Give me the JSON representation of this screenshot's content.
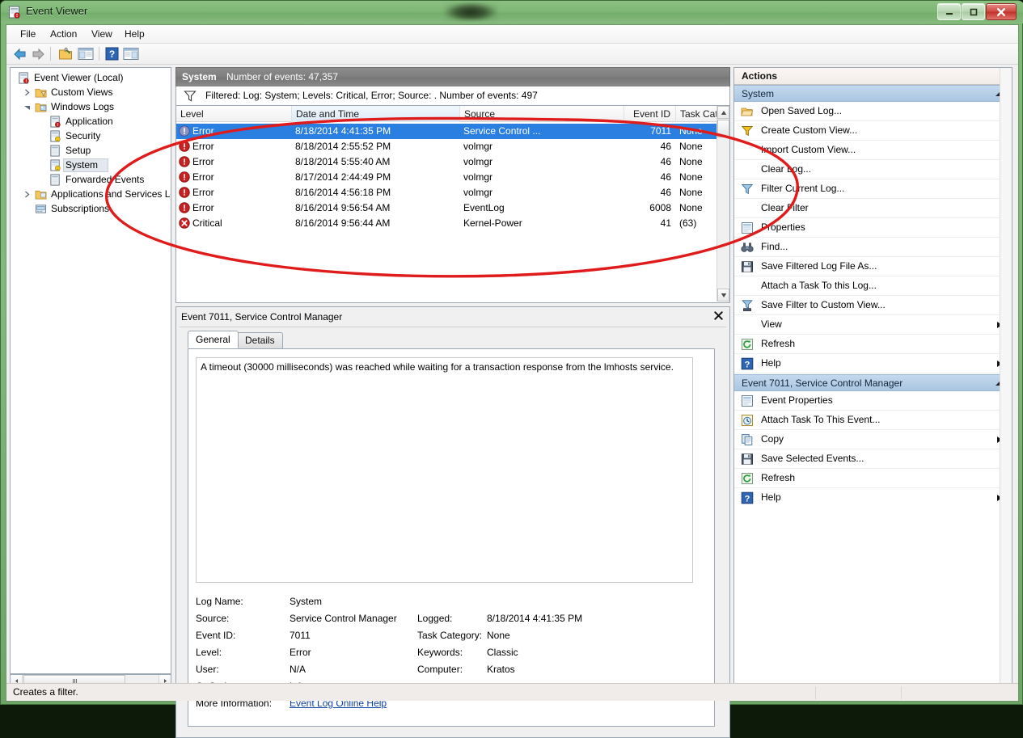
{
  "window": {
    "title": "Event Viewer",
    "icon": "event-viewer-icon",
    "buttons": {
      "minimize": "—",
      "maximize": "❐",
      "close": "✕"
    }
  },
  "menubar": {
    "items": [
      "File",
      "Action",
      "View",
      "Help"
    ]
  },
  "toolbar": {
    "items": [
      {
        "name": "back-icon",
        "glyph": "⬅"
      },
      {
        "name": "forward-icon",
        "glyph": "➡"
      },
      {
        "name": "show-hide-folder-icon",
        "glyph": "📂"
      },
      {
        "name": "show-hide-console-tree-icon",
        "glyph": "▤"
      },
      {
        "name": "help-icon",
        "glyph": "?"
      },
      {
        "name": "show-hide-action-pane-icon",
        "glyph": "▥"
      }
    ]
  },
  "tree": {
    "nodes": [
      {
        "label": "Event Viewer (Local)",
        "indent": 0,
        "expander": "none",
        "icon": "event-viewer-icon",
        "selected": false
      },
      {
        "label": "Custom Views",
        "indent": 1,
        "expander": "collapsed",
        "icon": "custom-views-folder-icon",
        "selected": false
      },
      {
        "label": "Windows Logs",
        "indent": 1,
        "expander": "expanded",
        "icon": "windows-logs-folder-icon",
        "selected": false
      },
      {
        "label": "Application",
        "indent": 2,
        "expander": "none",
        "icon": "log-icon",
        "selected": false
      },
      {
        "label": "Security",
        "indent": 2,
        "expander": "none",
        "icon": "log-key-icon",
        "selected": false
      },
      {
        "label": "Setup",
        "indent": 2,
        "expander": "none",
        "icon": "log-plain-icon",
        "selected": false
      },
      {
        "label": "System",
        "indent": 2,
        "expander": "none",
        "icon": "log-icon",
        "selected": true
      },
      {
        "label": "Forwarded Events",
        "indent": 2,
        "expander": "none",
        "icon": "log-plain-icon",
        "selected": false
      },
      {
        "label": "Applications and Services Lo",
        "indent": 1,
        "expander": "collapsed",
        "icon": "app-services-folder-icon",
        "selected": false
      },
      {
        "label": "Subscriptions",
        "indent": 1,
        "expander": "none",
        "icon": "subscriptions-icon",
        "selected": false
      }
    ]
  },
  "list": {
    "header_log": "System",
    "header_count": "Number of events: 47,357",
    "filter_text": "Filtered: Log: System; Levels: Critical, Error; Source: . Number of events: 497",
    "columns": [
      "Level",
      "Date and Time",
      "Source",
      "Event ID",
      "Task Category"
    ],
    "rows": [
      {
        "level": "Error",
        "icon": "error-icon",
        "datetime": "8/18/2014 4:41:35 PM",
        "source": "Service Control ...",
        "event_id": "7011",
        "task_category": "None",
        "selected": true
      },
      {
        "level": "Error",
        "icon": "error-icon",
        "datetime": "8/18/2014 2:55:52 PM",
        "source": "volmgr",
        "event_id": "46",
        "task_category": "None",
        "selected": false
      },
      {
        "level": "Error",
        "icon": "error-icon",
        "datetime": "8/18/2014 5:55:40 AM",
        "source": "volmgr",
        "event_id": "46",
        "task_category": "None",
        "selected": false
      },
      {
        "level": "Error",
        "icon": "error-icon",
        "datetime": "8/17/2014 2:44:49 PM",
        "source": "volmgr",
        "event_id": "46",
        "task_category": "None",
        "selected": false
      },
      {
        "level": "Error",
        "icon": "error-icon",
        "datetime": "8/16/2014 4:56:18 PM",
        "source": "volmgr",
        "event_id": "46",
        "task_category": "None",
        "selected": false
      },
      {
        "level": "Error",
        "icon": "error-icon",
        "datetime": "8/16/2014 9:56:54 AM",
        "source": "EventLog",
        "event_id": "6008",
        "task_category": "None",
        "selected": false
      },
      {
        "level": "Critical",
        "icon": "critical-icon",
        "datetime": "8/16/2014 9:56:44 AM",
        "source": "Kernel-Power",
        "event_id": "41",
        "task_category": "(63)",
        "selected": false
      }
    ]
  },
  "detail": {
    "title": "Event 7011, Service Control Manager",
    "close_glyph": "✖",
    "tabs": [
      {
        "label": "General",
        "active": true
      },
      {
        "label": "Details",
        "active": false
      }
    ],
    "message": "A timeout (30000 milliseconds) was reached while waiting for a transaction response from the lmhosts service.",
    "fields_left": [
      {
        "label": "Log Name:",
        "value": "System"
      },
      {
        "label": "Source:",
        "value": "Service Control Manager"
      },
      {
        "label": "Event ID:",
        "value": "7011"
      },
      {
        "label": "Level:",
        "value": "Error"
      },
      {
        "label": "User:",
        "value": "N/A"
      },
      {
        "label": "OpCode:",
        "value": "Info"
      }
    ],
    "fields_right": [
      {
        "label": "Logged:",
        "value": "8/18/2014 4:41:35 PM"
      },
      {
        "label": "Task Category:",
        "value": "None"
      },
      {
        "label": "Keywords:",
        "value": "Classic"
      },
      {
        "label": "Computer:",
        "value": "Kratos"
      }
    ],
    "more_information_label": "More Information:",
    "more_information_link": "Event Log Online Help"
  },
  "actions": {
    "title": "Actions",
    "groups": [
      {
        "title": "System",
        "items": [
          {
            "label": "Open Saved Log...",
            "icon": "open-folder-icon",
            "submenu": false
          },
          {
            "label": "Create Custom View...",
            "icon": "filter-funnel-icon",
            "submenu": false
          },
          {
            "label": "Import Custom View...",
            "icon": "none",
            "submenu": false
          },
          {
            "label": "Clear Log...",
            "icon": "none",
            "submenu": false
          },
          {
            "label": "Filter Current Log...",
            "icon": "filter-funnel-icon",
            "submenu": false
          },
          {
            "label": "Clear Filter",
            "icon": "none",
            "submenu": false
          },
          {
            "label": "Properties",
            "icon": "properties-icon",
            "submenu": false
          },
          {
            "label": "Find...",
            "icon": "binoculars-icon",
            "submenu": false
          },
          {
            "label": "Save Filtered Log File As...",
            "icon": "save-disk-icon",
            "submenu": false
          },
          {
            "label": "Attach a Task To this Log...",
            "icon": "none",
            "submenu": false
          },
          {
            "label": "Save Filter to Custom View...",
            "icon": "save-filter-icon",
            "submenu": false
          },
          {
            "label": "View",
            "icon": "none",
            "submenu": true
          },
          {
            "label": "Refresh",
            "icon": "refresh-icon",
            "submenu": false
          },
          {
            "label": "Help",
            "icon": "help-icon",
            "submenu": true
          }
        ]
      },
      {
        "title": "Event 7011, Service Control Manager",
        "items": [
          {
            "label": "Event Properties",
            "icon": "properties-icon",
            "submenu": false
          },
          {
            "label": "Attach Task To This Event...",
            "icon": "clock-task-icon",
            "submenu": false
          },
          {
            "label": "Copy",
            "icon": "copy-icon",
            "submenu": true
          },
          {
            "label": "Save Selected Events...",
            "icon": "save-disk-icon",
            "submenu": false
          },
          {
            "label": "Refresh",
            "icon": "refresh-icon",
            "submenu": false
          },
          {
            "label": "Help",
            "icon": "help-icon",
            "submenu": true
          }
        ]
      }
    ]
  },
  "statusbar": {
    "text": "Creates a filter."
  },
  "annotation": {
    "shape": "red-ellipse",
    "color": "#e01b1b"
  },
  "colors": {
    "titlebar_green": "#7fb877",
    "selection_blue": "#2a7fe0",
    "group_header_blue": "#aac6e2",
    "list_header_gray": "#7e7e7e",
    "error_red": "#cc1f1f",
    "link_blue": "#0b3fa8"
  }
}
